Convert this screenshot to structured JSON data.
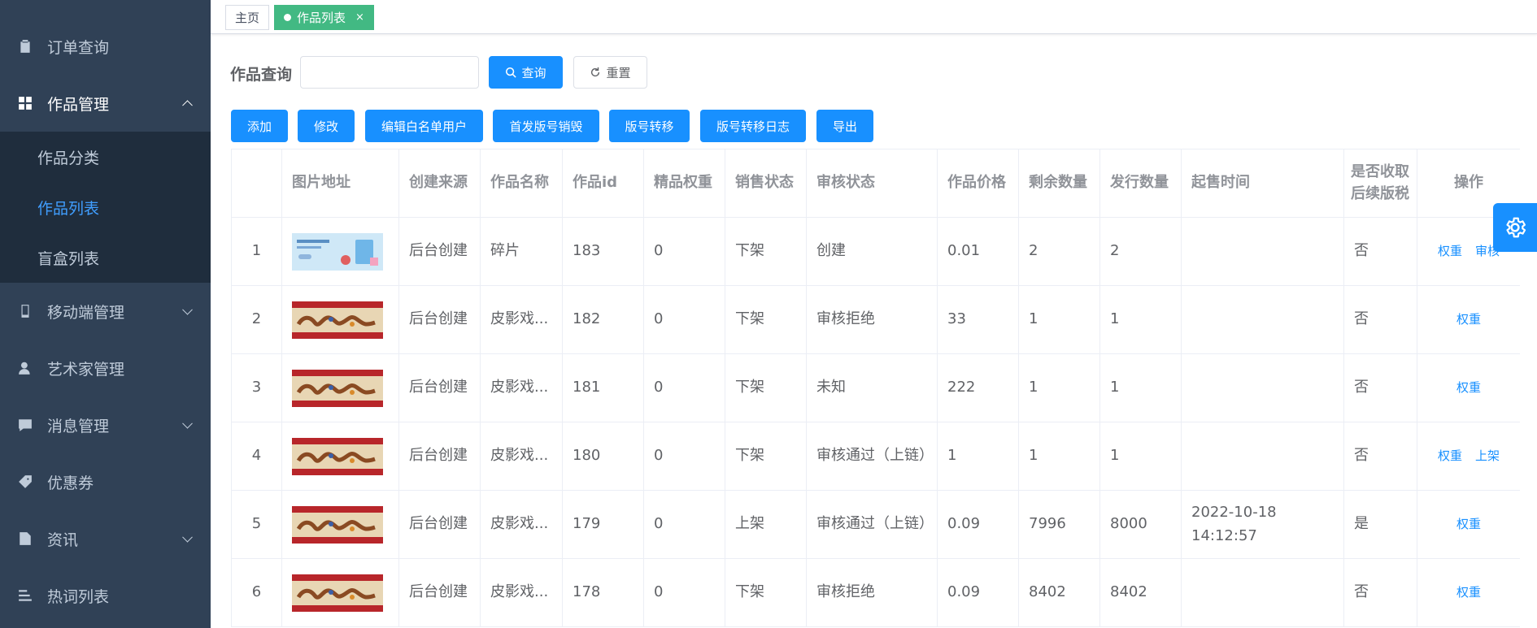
{
  "sidebar": {
    "items": [
      {
        "label": "订单查询",
        "icon": "clipboard-icon"
      },
      {
        "label": "作品管理",
        "icon": "dashboard-icon"
      },
      {
        "label": "移动端管理",
        "icon": "phone-icon"
      },
      {
        "label": "艺术家管理",
        "icon": "user-icon"
      },
      {
        "label": "消息管理",
        "icon": "message-icon"
      },
      {
        "label": "优惠券",
        "icon": "tag-icon"
      },
      {
        "label": "资讯",
        "icon": "document-icon"
      },
      {
        "label": "热词列表",
        "icon": "list-icon"
      }
    ],
    "submenu": [
      "作品分类",
      "作品列表",
      "盲盒列表"
    ]
  },
  "tags": {
    "home": "主页",
    "current": "作品列表",
    "close": "×"
  },
  "search": {
    "label": "作品查询",
    "value": "",
    "placeholder": "",
    "query_button": "查询",
    "reset_button": "重置"
  },
  "toolbar": {
    "buttons": [
      "添加",
      "修改",
      "编辑白名单用户",
      "首发版号销毁",
      "版号转移",
      "版号转移日志",
      "导出"
    ]
  },
  "table": {
    "headers": [
      "",
      "图片地址",
      "创建来源",
      "作品名称",
      "作品id",
      "精品权重",
      "销售状态",
      "审核状态",
      "作品价格",
      "剩余数量",
      "发行数量",
      "起售时间",
      "是否收取后续版税",
      "操作"
    ],
    "rows": [
      {
        "index": "1",
        "image": "blue-banner",
        "source": "后台创建",
        "name": "碎片",
        "id": "183",
        "weight": "0",
        "sale": "下架",
        "audit": "创建",
        "price": "0.01",
        "remain": "2",
        "issued": "2",
        "start": "",
        "royalty": "否",
        "ops": [
          "权重",
          "审核"
        ]
      },
      {
        "index": "2",
        "image": "red-banner",
        "source": "后台创建",
        "name": "皮影戏...",
        "id": "182",
        "weight": "0",
        "sale": "下架",
        "audit": "审核拒绝",
        "price": "33",
        "remain": "1",
        "issued": "1",
        "start": "",
        "royalty": "否",
        "ops": [
          "权重"
        ]
      },
      {
        "index": "3",
        "image": "red-banner",
        "source": "后台创建",
        "name": "皮影戏...",
        "id": "181",
        "weight": "0",
        "sale": "下架",
        "audit": "未知",
        "price": "222",
        "remain": "1",
        "issued": "1",
        "start": "",
        "royalty": "否",
        "ops": [
          "权重"
        ]
      },
      {
        "index": "4",
        "image": "red-banner",
        "source": "后台创建",
        "name": "皮影戏...",
        "id": "180",
        "weight": "0",
        "sale": "下架",
        "audit": "审核通过（上链）",
        "price": "1",
        "remain": "1",
        "issued": "1",
        "start": "",
        "royalty": "否",
        "ops": [
          "权重",
          "上架"
        ]
      },
      {
        "index": "5",
        "image": "red-banner",
        "source": "后台创建",
        "name": "皮影戏...",
        "id": "179",
        "weight": "0",
        "sale": "上架",
        "audit": "审核通过（上链）",
        "price": "0.09",
        "remain": "7996",
        "issued": "8000",
        "start": "2022-10-18 14:12:57",
        "royalty": "是",
        "ops": [
          "权重"
        ]
      },
      {
        "index": "6",
        "image": "red-banner",
        "source": "后台创建",
        "name": "皮影戏...",
        "id": "178",
        "weight": "0",
        "sale": "下架",
        "audit": "审核拒绝",
        "price": "0.09",
        "remain": "8402",
        "issued": "8402",
        "start": "",
        "royalty": "否",
        "ops": [
          "权重"
        ]
      }
    ]
  },
  "colors": {
    "sidebar_bg": "#304156",
    "submenu_bg": "#1f2d3d",
    "primary": "#1890ff",
    "active_tag": "#42b983",
    "active_sub": "#409eff"
  }
}
